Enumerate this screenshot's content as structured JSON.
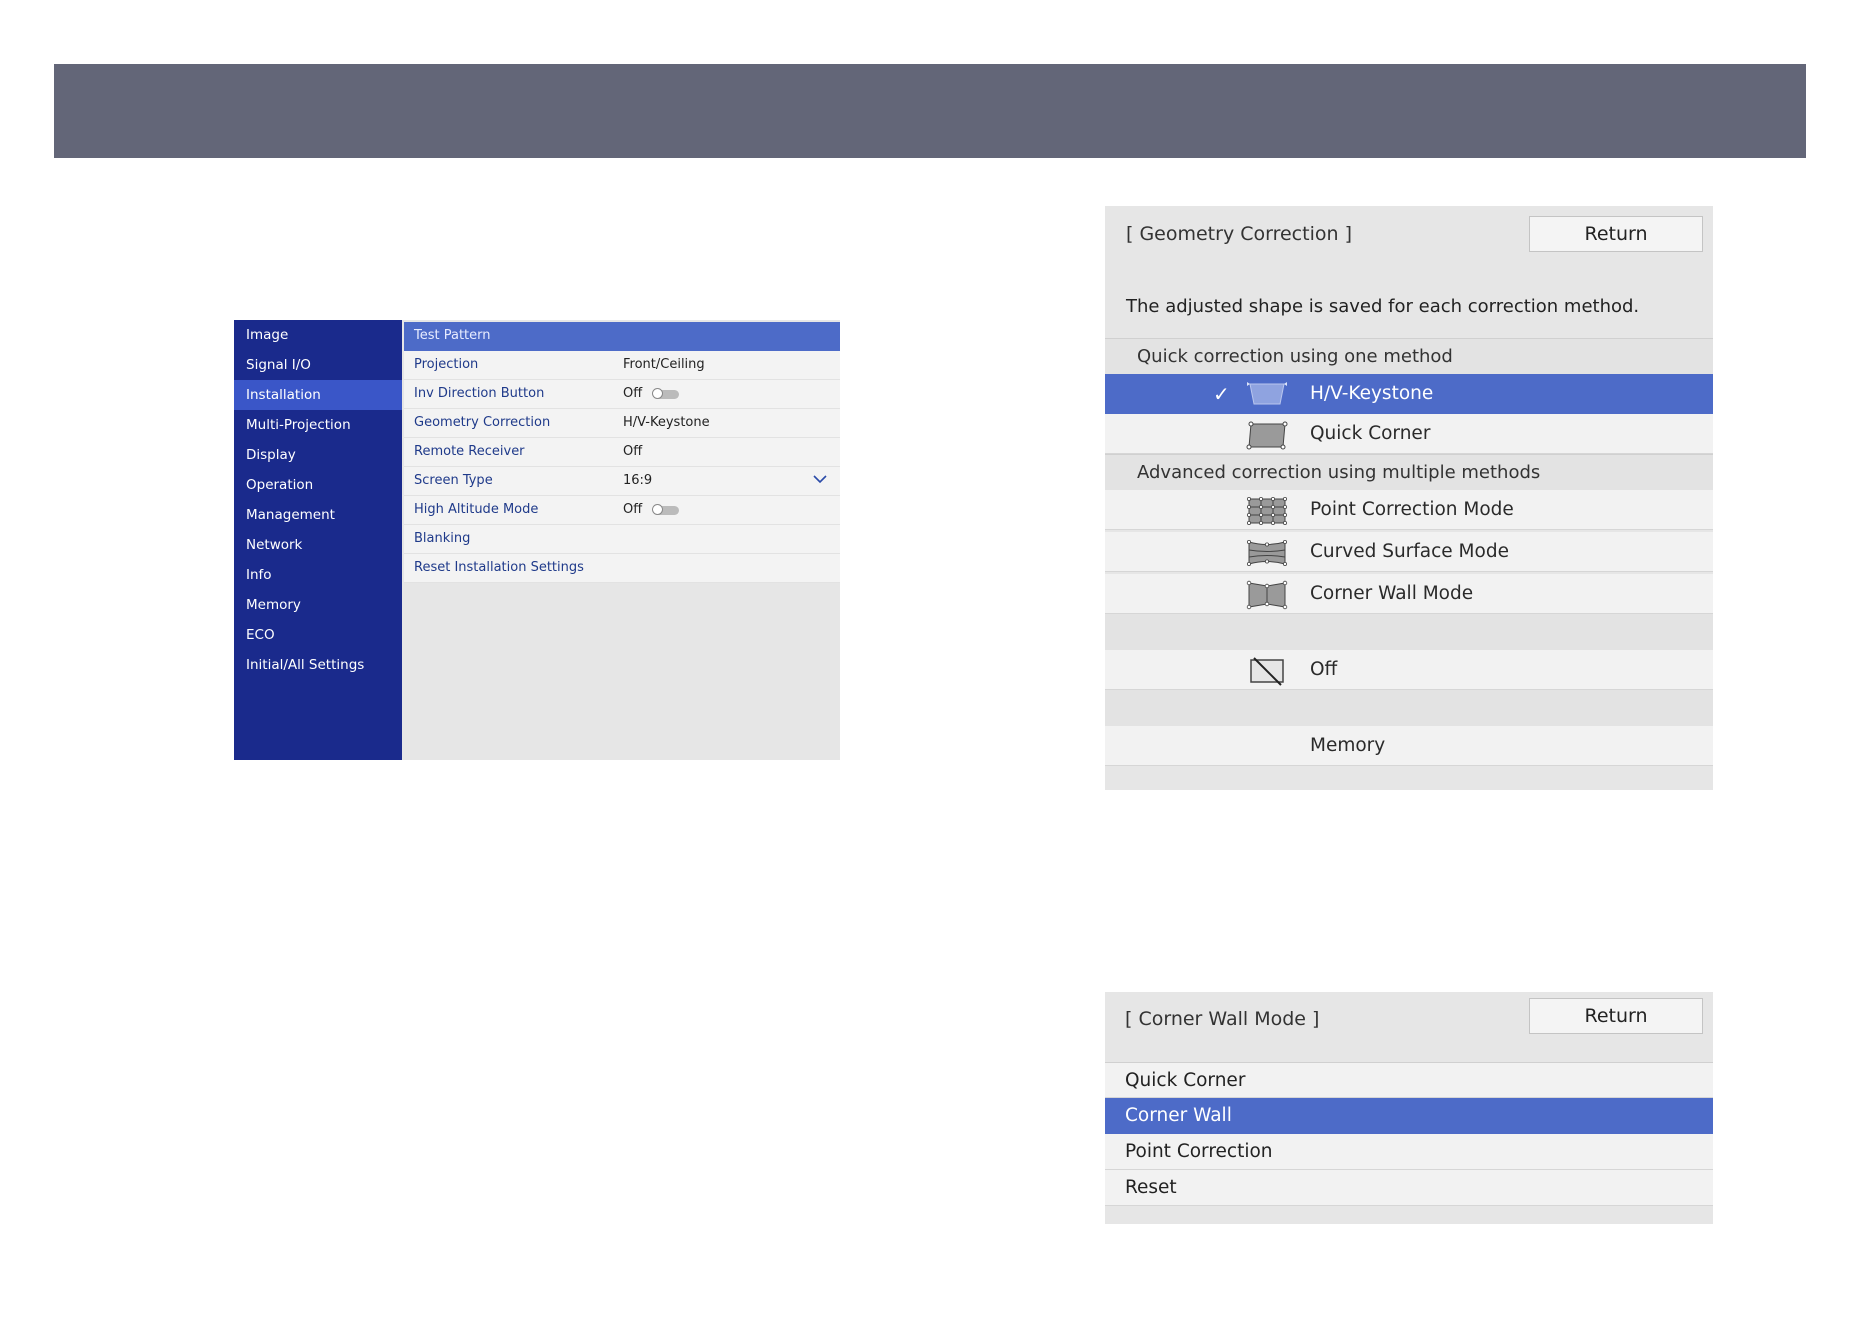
{
  "menu": {
    "sidebar": [
      {
        "label": "Image"
      },
      {
        "label": "Signal I/O"
      },
      {
        "label": "Installation"
      },
      {
        "label": "Multi-Projection"
      },
      {
        "label": "Display"
      },
      {
        "label": "Operation"
      },
      {
        "label": "Management"
      },
      {
        "label": "Network"
      },
      {
        "label": "Info"
      },
      {
        "label": "Memory"
      },
      {
        "label": "ECO"
      },
      {
        "label": "Initial/All Settings"
      }
    ],
    "active_index": 2,
    "rows": [
      {
        "label": "Test Pattern",
        "value": ""
      },
      {
        "label": "Projection",
        "value": "Front/Ceiling"
      },
      {
        "label": "Inv Direction Button",
        "value": "Off"
      },
      {
        "label": "Geometry Correction",
        "value": "H/V-Keystone"
      },
      {
        "label": "Remote Receiver",
        "value": "Off"
      },
      {
        "label": "Screen Type",
        "value": "16:9"
      },
      {
        "label": "High Altitude Mode",
        "value": "Off"
      },
      {
        "label": "Blanking",
        "value": ""
      },
      {
        "label": "Reset Installation Settings",
        "value": ""
      }
    ]
  },
  "geometry": {
    "title": "[ Geometry Correction ]",
    "return_label": "Return",
    "description": "The adjusted shape is saved for each correction method.",
    "quick_header": "Quick correction using one method",
    "quick_items": [
      {
        "label": "H/V-Keystone",
        "icon": "keystone-icon",
        "selected": true
      },
      {
        "label": "Quick Corner",
        "icon": "quick-corner-icon",
        "selected": false
      }
    ],
    "advanced_header": "Advanced correction using multiple methods",
    "advanced_items": [
      {
        "label": "Point Correction Mode",
        "icon": "point-correction-icon"
      },
      {
        "label": "Curved Surface Mode",
        "icon": "curved-surface-icon"
      },
      {
        "label": "Corner Wall Mode",
        "icon": "corner-wall-icon"
      }
    ],
    "off_label": "Off",
    "memory_label": "Memory"
  },
  "corner_wall": {
    "title": "[ Corner Wall Mode ]",
    "return_label": "Return",
    "items": [
      {
        "label": "Quick Corner",
        "selected": false
      },
      {
        "label": "Corner Wall",
        "selected": true
      },
      {
        "label": "Point Correction",
        "selected": false
      },
      {
        "label": "Reset",
        "selected": false
      }
    ]
  },
  "colors": {
    "topbar": "#636678",
    "sidebar": "#1a2a8c",
    "sidebar_active": "#3a56c8",
    "highlight": "#4d6bc8"
  }
}
